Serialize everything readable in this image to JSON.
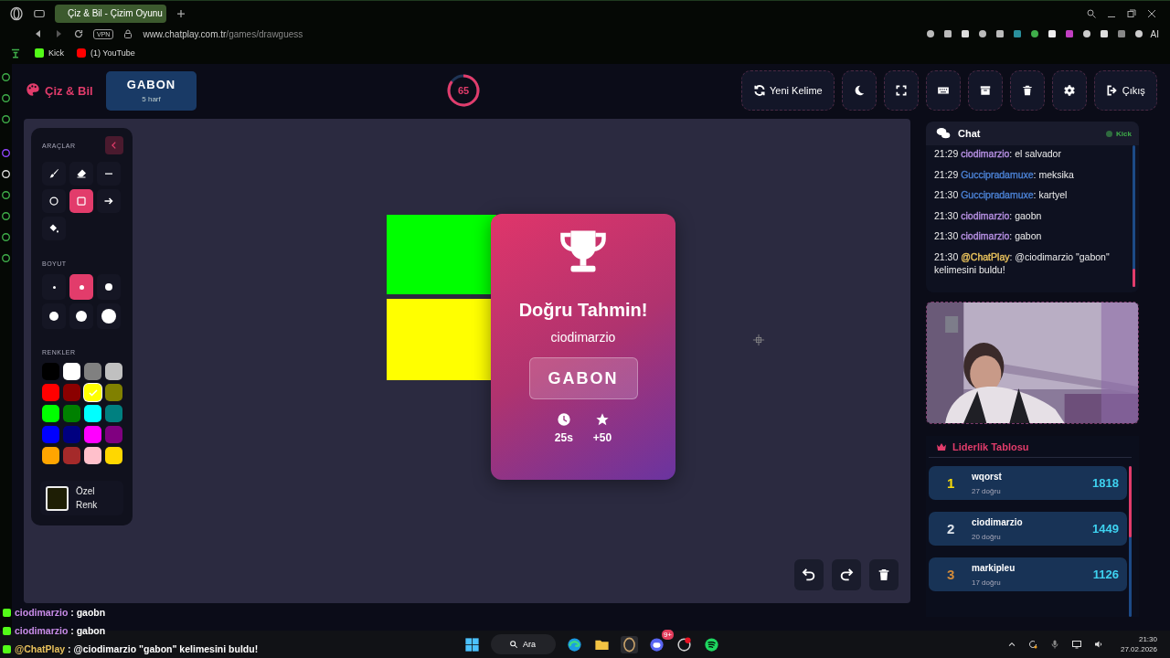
{
  "browser": {
    "tabs": [
      {
        "title": "Çiz & Bil - Çizim Oyunu",
        "selected": true
      }
    ],
    "vpn": "VPN",
    "url_host": "www.chatplay.com.tr",
    "url_path": "/games/drawguess",
    "ai": "AI",
    "bookmarks": [
      {
        "label": "Kick",
        "kind": "kick"
      },
      {
        "label": "(1) YouTube",
        "kind": "youtube"
      }
    ]
  },
  "header": {
    "logo": "Çiz & Bil",
    "word": {
      "text": "GABON",
      "hint": "5 harf"
    },
    "timer": {
      "value": "65"
    },
    "buttons": [
      {
        "kind": "refresh",
        "label": "Yeni Kelime"
      },
      {
        "kind": "moon"
      },
      {
        "kind": "expand"
      },
      {
        "kind": "keyboard"
      },
      {
        "kind": "archive"
      },
      {
        "kind": "trash"
      },
      {
        "kind": "gear"
      },
      {
        "kind": "exit",
        "label": "Çıkış"
      }
    ]
  },
  "tools_panel": {
    "title": "ARAÇLAR",
    "tools": [
      {
        "kind": "brush",
        "selected": false
      },
      {
        "kind": "eraser",
        "selected": false
      },
      {
        "kind": "line",
        "selected": false
      },
      {
        "kind": "circle",
        "selected": false
      },
      {
        "kind": "rect",
        "selected": true
      },
      {
        "kind": "arrow",
        "selected": false
      },
      {
        "kind": "fill",
        "selected": false
      }
    ],
    "size_title": "BOYUT",
    "sizes": [
      {
        "kind": "xs",
        "selected": false
      },
      {
        "kind": "s",
        "selected": true
      },
      {
        "kind": "m",
        "selected": false
      },
      {
        "kind": "l",
        "selected": false
      },
      {
        "kind": "xl",
        "selected": false
      },
      {
        "kind": "xxl",
        "selected": false
      }
    ],
    "color_title": "RENKLER",
    "colors": [
      {
        "color": "#000000",
        "selected": false
      },
      {
        "color": "#ffffff",
        "selected": false
      },
      {
        "color": "#808080",
        "selected": false
      },
      {
        "color": "#c0c0c0",
        "selected": false
      },
      {
        "color": "#ff0000",
        "selected": false
      },
      {
        "color": "#8b0000",
        "selected": false
      },
      {
        "color": "#ffff00",
        "selected": true
      },
      {
        "color": "#808000",
        "selected": false
      },
      {
        "color": "#00ff00",
        "selected": false
      },
      {
        "color": "#008000",
        "selected": false
      },
      {
        "color": "#00ffff",
        "selected": false
      },
      {
        "color": "#008080",
        "selected": false
      },
      {
        "color": "#0000ff",
        "selected": false
      },
      {
        "color": "#000080",
        "selected": false
      },
      {
        "color": "#ff00ff",
        "selected": false
      },
      {
        "color": "#800080",
        "selected": false
      },
      {
        "color": "#ffa500",
        "selected": false
      },
      {
        "color": "#a52a2a",
        "selected": false
      },
      {
        "color": "#ffc0cb",
        "selected": false
      },
      {
        "color": "#ffd700",
        "selected": false
      }
    ],
    "custom": {
      "label": "Özel Renk",
      "color": "#1e1e05"
    }
  },
  "drawing": [
    {
      "color": "#00ff00"
    },
    {
      "color": "#ffff00"
    }
  ],
  "result": {
    "title": "Doğru Tahmin!",
    "player": "ciodimarzio",
    "word": "GABON",
    "stats": [
      {
        "kind": "clock",
        "value": "25s"
      },
      {
        "kind": "star",
        "value": "+50"
      }
    ]
  },
  "canvas_actions": [
    {
      "kind": "undo"
    },
    {
      "kind": "redo"
    },
    {
      "kind": "trash"
    }
  ],
  "chat": {
    "title": "Chat",
    "source": "Kick",
    "messages": [
      {
        "time": "21:29",
        "user": "ciodimarzio",
        "text": ": el salvador",
        "color": "#b48ee0"
      },
      {
        "time": "21:29",
        "user": "Guccipradamuxe",
        "text": ": meksika",
        "color": "#4a7fd0"
      },
      {
        "time": "21:30",
        "user": "Guccipradamuxe",
        "text": ": kartyel",
        "color": "#4a7fd0"
      },
      {
        "time": "21:30",
        "user": "ciodimarzio",
        "text": ": gaobn",
        "color": "#b48ee0"
      },
      {
        "time": "21:30",
        "user": "ciodimarzio",
        "text": ": gabon",
        "color": "#b48ee0"
      },
      {
        "time": "21:30",
        "user": "@ChatPlay",
        "text": ": @ciodimarzio \"gabon\" kelimesini buldu!",
        "color": "#e8c15c"
      }
    ]
  },
  "leaderboard": {
    "title": "Liderlik Tablosu",
    "entries": [
      {
        "rank": "1",
        "name": "wqorst",
        "detail": "27 doğru",
        "score": "1818",
        "color": "#f5d90a"
      },
      {
        "rank": "2",
        "name": "ciodimarzio",
        "detail": "20 doğru",
        "score": "1449",
        "color": "#dde3ea"
      },
      {
        "rank": "3",
        "name": "markipleu",
        "detail": "17 doğru",
        "score": "1126",
        "color": "#d08a3a"
      }
    ]
  },
  "overlay_chat": [
    {
      "user": "ciodimarzio",
      "text": " : gaobn",
      "color": "#c98ce8"
    },
    {
      "user": "ciodimarzio",
      "text": " : gabon",
      "color": "#c98ce8"
    },
    {
      "user": "@ChatPlay",
      "text": " : @ciodimarzio \"gabon\" kelimesini buldu!",
      "color": "#e8c15c"
    }
  ],
  "taskbar": {
    "search": "Ara",
    "badge": "9+",
    "time": "21:30",
    "date": "27.02.2026"
  }
}
